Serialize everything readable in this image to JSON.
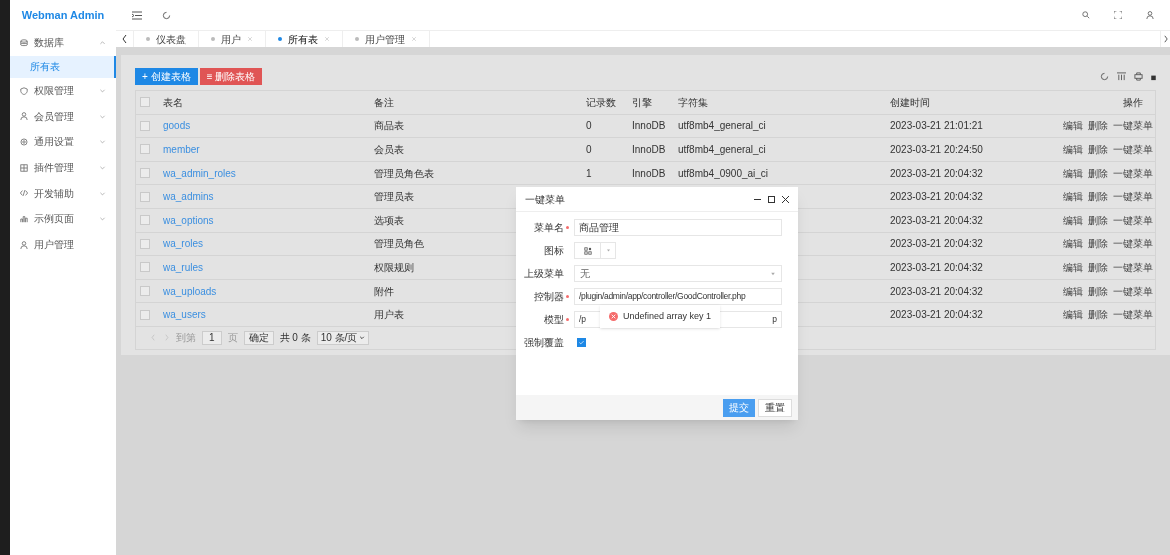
{
  "brand": "Webman Admin",
  "sidebar": {
    "items": [
      {
        "label": "数据库",
        "expanded": true,
        "children": [
          {
            "label": "所有表",
            "selected": true
          }
        ]
      },
      {
        "label": "权限管理",
        "expanded": false
      },
      {
        "label": "会员管理",
        "expanded": false
      },
      {
        "label": "通用设置",
        "expanded": false
      },
      {
        "label": "插件管理",
        "expanded": false
      },
      {
        "label": "开发辅助",
        "expanded": false
      },
      {
        "label": "示例页面",
        "expanded": false
      },
      {
        "label": "用户管理"
      }
    ]
  },
  "tabs": [
    {
      "label": "仪表盘",
      "selected": false,
      "closable": false
    },
    {
      "label": "用户",
      "selected": false,
      "closable": true
    },
    {
      "label": "所有表",
      "selected": true,
      "closable": true
    },
    {
      "label": "用户管理",
      "selected": false,
      "closable": true
    }
  ],
  "toolbar": {
    "buttons": [
      {
        "label": "+ 创建表格",
        "kind": "primary"
      },
      {
        "label": "≡ 删除表格",
        "kind": "danger"
      }
    ]
  },
  "table": {
    "columns": [
      "表名",
      "备注",
      "记录数",
      "引擎",
      "字符集",
      "创建时间",
      "操作"
    ],
    "header_checked": false,
    "rows": [
      {
        "name": "goods",
        "comment": "商品表",
        "count": "0",
        "engine": "InnoDB",
        "charset": "utf8mb4_general_ci",
        "created": "2023-03-21 21:01:21",
        "checked": false,
        "actions": [
          "编辑",
          "删除",
          "一键菜单"
        ]
      },
      {
        "name": "member",
        "comment": "会员表",
        "count": "0",
        "engine": "InnoDB",
        "charset": "utf8mb4_general_ci",
        "created": "2023-03-21 20:24:50",
        "checked": false,
        "actions": [
          "编辑",
          "删除",
          "一键菜单"
        ]
      },
      {
        "name": "wa_admin_roles",
        "comment": "管理员角色表",
        "count": "1",
        "engine": "InnoDB",
        "charset": "utf8mb4_0900_ai_ci",
        "created": "2023-03-21 20:04:32",
        "checked": false,
        "actions": [
          "编辑",
          "删除",
          "一键菜单"
        ]
      },
      {
        "name": "wa_admins",
        "comment": "管理员表",
        "created": "2023-03-21 20:04:32",
        "checked": false,
        "actions": [
          "编辑",
          "删除",
          "一键菜单"
        ]
      },
      {
        "name": "wa_options",
        "comment": "选项表",
        "created": "2023-03-21 20:04:32",
        "checked": false,
        "actions": [
          "编辑",
          "删除",
          "一键菜单"
        ]
      },
      {
        "name": "wa_roles",
        "comment": "管理员角色",
        "created": "2023-03-21 20:04:32",
        "checked": false,
        "actions": [
          "编辑",
          "删除",
          "一键菜单"
        ]
      },
      {
        "name": "wa_rules",
        "comment": "权限规则",
        "created": "2023-03-21 20:04:32",
        "checked": false,
        "actions": [
          "编辑",
          "删除",
          "一键菜单"
        ]
      },
      {
        "name": "wa_uploads",
        "comment": "附件",
        "created": "2023-03-21 20:04:32",
        "checked": false,
        "actions": [
          "编辑",
          "删除",
          "一键菜单"
        ]
      },
      {
        "name": "wa_users",
        "comment": "用户表",
        "created": "2023-03-21 20:04:32",
        "checked": false,
        "actions": [
          "编辑",
          "删除",
          "一键菜单"
        ]
      }
    ]
  },
  "pagination": {
    "goto": "到第",
    "page": "1",
    "page_unit": "页",
    "confirm": "确定",
    "total": "共 0 条",
    "page_size": "10 条/页"
  },
  "dialog": {
    "title": "一键菜单",
    "fields": [
      {
        "label": "菜单名",
        "kind": "text",
        "required": true,
        "value": "商品管理"
      },
      {
        "label": "图标",
        "kind": "icon",
        "required": false
      },
      {
        "label": "上级菜单",
        "kind": "select",
        "required": false,
        "value": "无"
      },
      {
        "label": "控制器",
        "kind": "text",
        "required": true,
        "value": "/plugin/admin/app/controller/GoodController.php"
      },
      {
        "label": "模型",
        "kind": "split",
        "required": true,
        "value_parts": [
          "/p",
          "p"
        ]
      },
      {
        "label": "强制覆盖",
        "kind": "checkbox",
        "required": false,
        "checked": true
      }
    ],
    "buttons": [
      {
        "label": "提交",
        "kind": "primary"
      },
      {
        "label": "重置",
        "kind": "default"
      }
    ]
  },
  "toast": {
    "message": "Undefined array key 1"
  }
}
